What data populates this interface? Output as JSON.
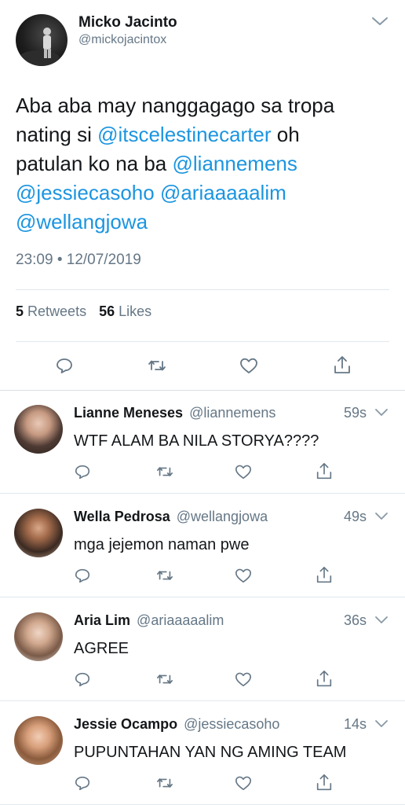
{
  "main_tweet": {
    "author_name": "Micko Jacinto",
    "author_handle": "@mickojacintox",
    "text_plain_1": "Aba aba may nanggagago sa tropa",
    "text_plain_2": "nating si ",
    "mention_1": "@itscelestinecarter",
    "text_plain_3": " oh",
    "text_plain_4": "patulan ko na ba ",
    "mention_2": "@liannemens",
    "mention_3": "@jessiecasoho",
    "mention_4": "@ariaaaaalim",
    "mention_5": "@wellangjowa",
    "timestamp": "23:09 • 12/07/2019",
    "retweet_count": "5",
    "retweet_label": "Retweets",
    "like_count": "56",
    "like_label": "Likes"
  },
  "replies": [
    {
      "name": "Lianne Meneses",
      "handle": "@liannemens",
      "time": "59s",
      "text": "WTF ALAM BA NILA STORYA????"
    },
    {
      "name": "Wella Pedrosa",
      "handle": "@wellangjowa",
      "time": "49s",
      "text": "mga jejemon naman pwe"
    },
    {
      "name": "Aria Lim",
      "handle": "@ariaaaaalim",
      "time": "36s",
      "text": "AGREE"
    },
    {
      "name": "Jessie Ocampo",
      "handle": "@jessiecasoho",
      "time": "14s",
      "text": "PUPUNTAHAN YAN NG AMING TEAM"
    }
  ],
  "icons": {
    "reply": "reply-icon",
    "retweet": "retweet-icon",
    "like": "like-icon",
    "share": "share-icon",
    "more": "chevron-down-icon"
  },
  "colors": {
    "link": "#1b95e0",
    "muted": "#657786",
    "text": "#14171a",
    "divider": "#e1e8ed"
  }
}
